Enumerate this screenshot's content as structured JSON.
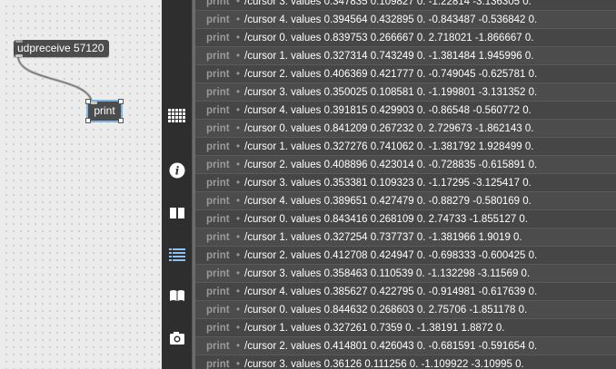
{
  "patcher": {
    "objects": {
      "udpreceive": "udpreceive 57120",
      "print": "print"
    }
  },
  "toolbar": {
    "buttons": [
      {
        "name": "grid-icon",
        "symbol": "grid"
      },
      {
        "name": "info-icon",
        "symbol": "i"
      },
      {
        "name": "reference-book-icon",
        "symbol": "book"
      },
      {
        "name": "list-icon",
        "symbol": "list"
      },
      {
        "name": "open-book-icon",
        "symbol": "book-open"
      },
      {
        "name": "snapshot-icon",
        "symbol": "camera"
      }
    ]
  },
  "console": {
    "bullet": "•",
    "rows": [
      {
        "source": "print",
        "message": "/cursor 3. values 0.347835 0.109827 0. -1.22814 -3.136305 0."
      },
      {
        "source": "print",
        "message": "/cursor 4. values 0.394564 0.432895 0. -0.843487 -0.536842 0."
      },
      {
        "source": "print",
        "message": "/cursor 0. values 0.839753 0.266667 0. 2.718021 -1.866667 0."
      },
      {
        "source": "print",
        "message": "/cursor 1. values 0.327314 0.743249 0. -1.381484 1.945996 0."
      },
      {
        "source": "print",
        "message": "/cursor 2. values 0.406369 0.421777 0. -0.749045 -0.625781 0."
      },
      {
        "source": "print",
        "message": "/cursor 3. values 0.350025 0.108581 0. -1.199801 -3.131352 0."
      },
      {
        "source": "print",
        "message": "/cursor 4. values 0.391815 0.429903 0. -0.86548 -0.560772 0."
      },
      {
        "source": "print",
        "message": "/cursor 0. values 0.841209 0.267232 0. 2.729673 -1.862143 0."
      },
      {
        "source": "print",
        "message": "/cursor 1. values 0.327276 0.741062 0. -1.381792 1.928499 0."
      },
      {
        "source": "print",
        "message": "/cursor 2. values 0.408896 0.423014 0. -0.728835 -0.615891 0."
      },
      {
        "source": "print",
        "message": "/cursor 3. values 0.353381 0.109323 0. -1.17295 -3.125417 0."
      },
      {
        "source": "print",
        "message": "/cursor 4. values 0.389651 0.427479 0. -0.88279 -0.580169 0."
      },
      {
        "source": "print",
        "message": "/cursor 0. values 0.843416 0.268109 0. 2.74733 -1.855127 0."
      },
      {
        "source": "print",
        "message": "/cursor 1. values 0.327254 0.737737 0. -1.381966 1.9019 0."
      },
      {
        "source": "print",
        "message": "/cursor 2. values 0.412708 0.424947 0. -0.698333 -0.600425 0."
      },
      {
        "source": "print",
        "message": "/cursor 3. values 0.358463 0.110539 0. -1.132298 -3.11569 0."
      },
      {
        "source": "print",
        "message": "/cursor 4. values 0.385627 0.422795 0. -0.914981 -0.617639 0."
      },
      {
        "source": "print",
        "message": "/cursor 0. values 0.844632 0.268603 0. 2.75706 -1.851178 0."
      },
      {
        "source": "print",
        "message": "/cursor 1. values 0.327261 0.7359 0. -1.38191 1.8872 0."
      },
      {
        "source": "print",
        "message": "/cursor 2. values 0.414801 0.426043 0. -0.681591 -0.591654 0."
      },
      {
        "source": "print",
        "message": "/cursor 3. values 0.36126 0.111256 0. -1.109922 -3.10995 0."
      }
    ]
  }
}
